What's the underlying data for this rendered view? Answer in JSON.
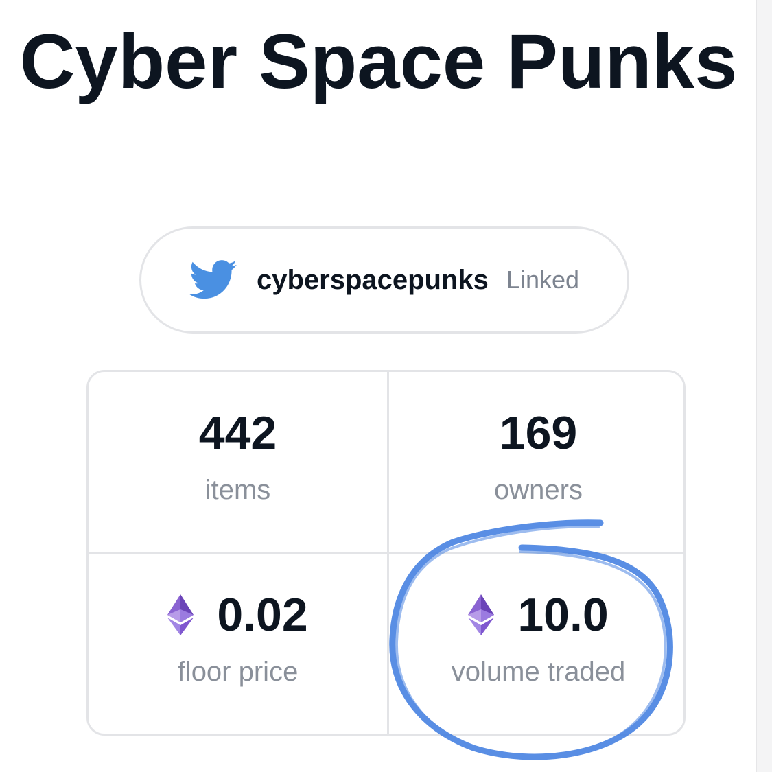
{
  "header": {
    "title": "Cyber Space Punks"
  },
  "social": {
    "icon": "twitter-icon",
    "handle": "cyberspacepunks",
    "status": "Linked",
    "icon_color": "#4a90e2"
  },
  "stats": {
    "items": {
      "value": "442",
      "label": "items"
    },
    "owners": {
      "value": "169",
      "label": "owners"
    },
    "floor_price": {
      "value": "0.02",
      "label": "floor price",
      "icon": "ethereum-icon"
    },
    "volume_traded": {
      "value": "10.0",
      "label": "volume traded",
      "icon": "ethereum-icon"
    }
  },
  "annotation": {
    "type": "hand-drawn circle",
    "color": "#3d7be0",
    "target": "volume traded"
  }
}
